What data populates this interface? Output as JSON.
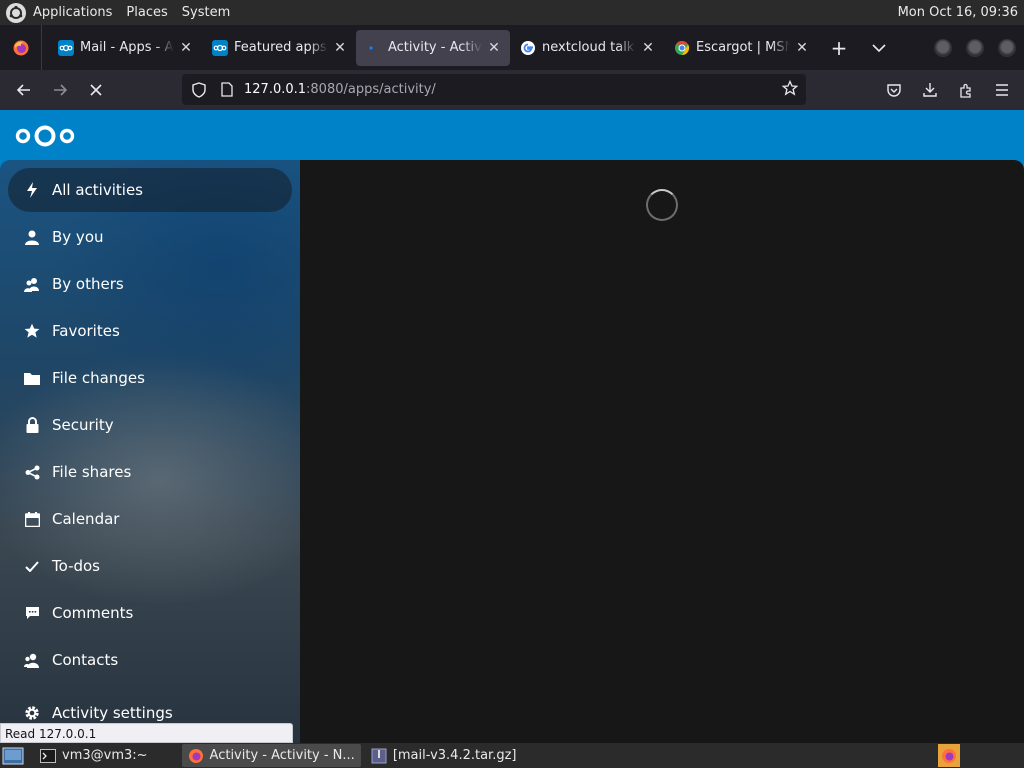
{
  "top_panel": {
    "menus": [
      "Applications",
      "Places",
      "System"
    ],
    "clock": "Mon Oct 16, 09:36"
  },
  "tabs": [
    {
      "title": "Mail - Apps - Ap",
      "icon": "nextcloud-icon",
      "active": false
    },
    {
      "title": "Featured apps -",
      "icon": "nextcloud-icon",
      "active": false
    },
    {
      "title": "Activity - Activity",
      "icon": "loading-dot-icon",
      "active": true
    },
    {
      "title": "nextcloud talk d",
      "icon": "google-icon",
      "active": false
    },
    {
      "title": "Escargot | MSN",
      "icon": "chrome-icon",
      "active": false
    }
  ],
  "url": {
    "host": "127.0.0.1",
    "path": ":8080/apps/activity/"
  },
  "sidebar": {
    "items": [
      {
        "label": "All activities",
        "icon": "lightning-icon"
      },
      {
        "label": "By you",
        "icon": "person-icon"
      },
      {
        "label": "By others",
        "icon": "people-icon"
      },
      {
        "label": "Favorites",
        "icon": "star-icon"
      },
      {
        "label": "File changes",
        "icon": "folder-icon"
      },
      {
        "label": "Security",
        "icon": "lock-icon"
      },
      {
        "label": "File shares",
        "icon": "share-icon"
      },
      {
        "label": "Calendar",
        "icon": "calendar-icon"
      },
      {
        "label": "To-dos",
        "icon": "checkmark-icon"
      },
      {
        "label": "Comments",
        "icon": "comment-icon"
      },
      {
        "label": "Contacts",
        "icon": "contacts-icon"
      }
    ],
    "settings_label": "Activity settings"
  },
  "status_text": "Read 127.0.0.1",
  "taskbar": {
    "items": [
      {
        "label": "vm3@vm3:~",
        "icon": "terminal-icon"
      },
      {
        "label": "Activity - Activity - N...",
        "icon": "firefox-icon"
      },
      {
        "label": "[mail-v3.4.2.tar.gz]",
        "icon": "archive-icon"
      }
    ]
  },
  "colors": {
    "nextcloud_blue": "#0082c9",
    "main_bg": "#171717",
    "browser_bg": "#1c1b22"
  }
}
